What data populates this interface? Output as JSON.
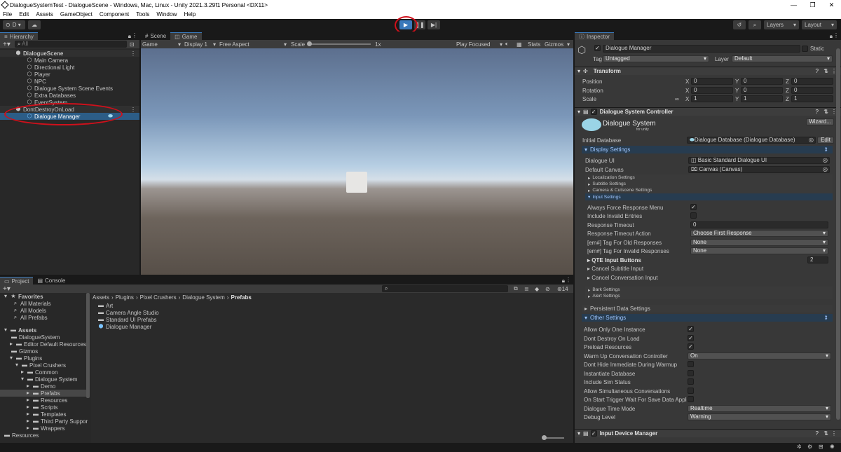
{
  "window": {
    "title": "DialogueSystemTest - DialogueScene - Windows, Mac, Linux - Unity 2021.3.29f1 Personal <DX11>",
    "minimize": "—",
    "maximize": "❐",
    "close": "✕"
  },
  "menu": [
    "File",
    "Edit",
    "Assets",
    "GameObject",
    "Component",
    "Tools",
    "Window",
    "Help"
  ],
  "toolbar": {
    "account": "D ▾",
    "layers": "Layers",
    "layout": "Layout"
  },
  "hierarchy": {
    "tab": "Hierarchy",
    "search_placeholder": "All",
    "items": [
      {
        "label": "DialogueScene"
      },
      {
        "label": "Main Camera"
      },
      {
        "label": "Directional Light"
      },
      {
        "label": "Player"
      },
      {
        "label": "NPC"
      },
      {
        "label": "Dialogue System Scene Events"
      },
      {
        "label": "Extra Databases"
      },
      {
        "label": "EventSystem"
      },
      {
        "label": "DontDestroyOnLoad"
      },
      {
        "label": "Dialogue Manager"
      }
    ]
  },
  "view": {
    "tabs": [
      "Scene",
      "Game"
    ],
    "game_select": "Game",
    "display": "Display 1",
    "aspect": "Free Aspect",
    "scale_label": "Scale",
    "scale_value": "1x",
    "play_focused": "Play Focused",
    "stats": "Stats",
    "gizmos": "Gizmos"
  },
  "project": {
    "tabs": [
      "Project",
      "Console"
    ],
    "count": "14",
    "favorites": [
      {
        "label": "Favorites"
      },
      {
        "label": "All Materials"
      },
      {
        "label": "All Models"
      },
      {
        "label": "All Prefabs"
      }
    ],
    "tree": [
      {
        "label": "Assets"
      },
      {
        "label": "DialogueSystem"
      },
      {
        "label": "Editor Default Resources"
      },
      {
        "label": "Gizmos"
      },
      {
        "label": "Plugins"
      },
      {
        "label": "Pixel Crushers"
      },
      {
        "label": "Common"
      },
      {
        "label": "Dialogue System"
      },
      {
        "label": "Demo"
      },
      {
        "label": "Prefabs"
      },
      {
        "label": "Resources"
      },
      {
        "label": "Scripts"
      },
      {
        "label": "Templates"
      },
      {
        "label": "Third Party Suppor"
      },
      {
        "label": "Wrappers"
      },
      {
        "label": "Resources"
      }
    ],
    "breadcrumb": [
      "Assets",
      "Plugins",
      "Pixel Crushers",
      "Dialogue System",
      "Prefabs"
    ],
    "files": [
      {
        "label": "Art"
      },
      {
        "label": "Camera Angle Studio"
      },
      {
        "label": "Standard UI Prefabs"
      },
      {
        "label": "Dialogue Manager"
      }
    ]
  },
  "inspector": {
    "tab": "Inspector",
    "object_name": "Dialogue Manager",
    "static": "Static",
    "tag_label": "Tag",
    "tag_value": "Untagged",
    "layer_label": "Layer",
    "layer_value": "Default",
    "transform": {
      "title": "Transform",
      "position": {
        "label": "Position",
        "x": "0",
        "y": "0",
        "z": "0"
      },
      "rotation": {
        "label": "Rotation",
        "x": "0",
        "y": "0",
        "z": "0"
      },
      "scale": {
        "label": "Scale",
        "x": "1",
        "y": "1",
        "z": "1"
      }
    },
    "dsc": {
      "title": "Dialogue System Controller",
      "logo_title": "Dialogue System",
      "logo_sub": "for unity",
      "wizard": "Wizard...",
      "initial_db_label": "Initial Database",
      "initial_db_value": "Dialogue Database (Dialogue Database)",
      "edit": "Edit",
      "display_settings": "Display Settings",
      "dialogue_ui_label": "Dialogue UI",
      "dialogue_ui_value": "Basic Standard Dialogue UI",
      "default_canvas_label": "Default Canvas",
      "default_canvas_value": "Canvas (Canvas)",
      "localization": "Localization Settings",
      "subtitle": "Subtitle Settings",
      "camera": "Camera & Cutscene Settings",
      "input": "Input Settings",
      "always_force": "Always Force Response Menu",
      "include_invalid": "Include Invalid Entries",
      "response_timeout": "Response Timeout",
      "response_timeout_value": "0",
      "timeout_action": "Response Timeout Action",
      "timeout_action_value": "Choose First Response",
      "tag_old": "[em#] Tag For Old Responses",
      "tag_old_value": "None",
      "tag_invalid": "[em#] Tag For Invalid Responses",
      "tag_invalid_value": "None",
      "qte": "QTE Input Buttons",
      "qte_value": "2",
      "cancel_subtitle": "Cancel Subtitle Input",
      "cancel_conv": "Cancel Conversation Input",
      "bark": "Bark Settings",
      "alert": "Alert Settings",
      "persistent": "Persistent Data Settings",
      "other": "Other Settings",
      "allow_one": "Allow Only One Instance",
      "dont_destroy": "Dont Destroy On Load",
      "preload": "Preload Resources",
      "warm_up": "Warm Up Conversation Controller",
      "warm_up_value": "On",
      "dont_hide": "Dont Hide Immediate During Warmup",
      "instantiate": "Instantiate Database",
      "include_sim": "Include Sim Status",
      "allow_sim": "Allow Simultaneous Conversations",
      "on_start": "On Start Trigger Wait For Save Data Applie",
      "time_mode": "Dialogue Time Mode",
      "time_mode_value": "Realtime",
      "debug": "Debug Level",
      "debug_value": "Warning"
    },
    "input_device": "Input Device Manager"
  },
  "colors": {
    "accent": "#3a79bb",
    "highlight": "#d0101b",
    "selected": "#2c5d87"
  }
}
